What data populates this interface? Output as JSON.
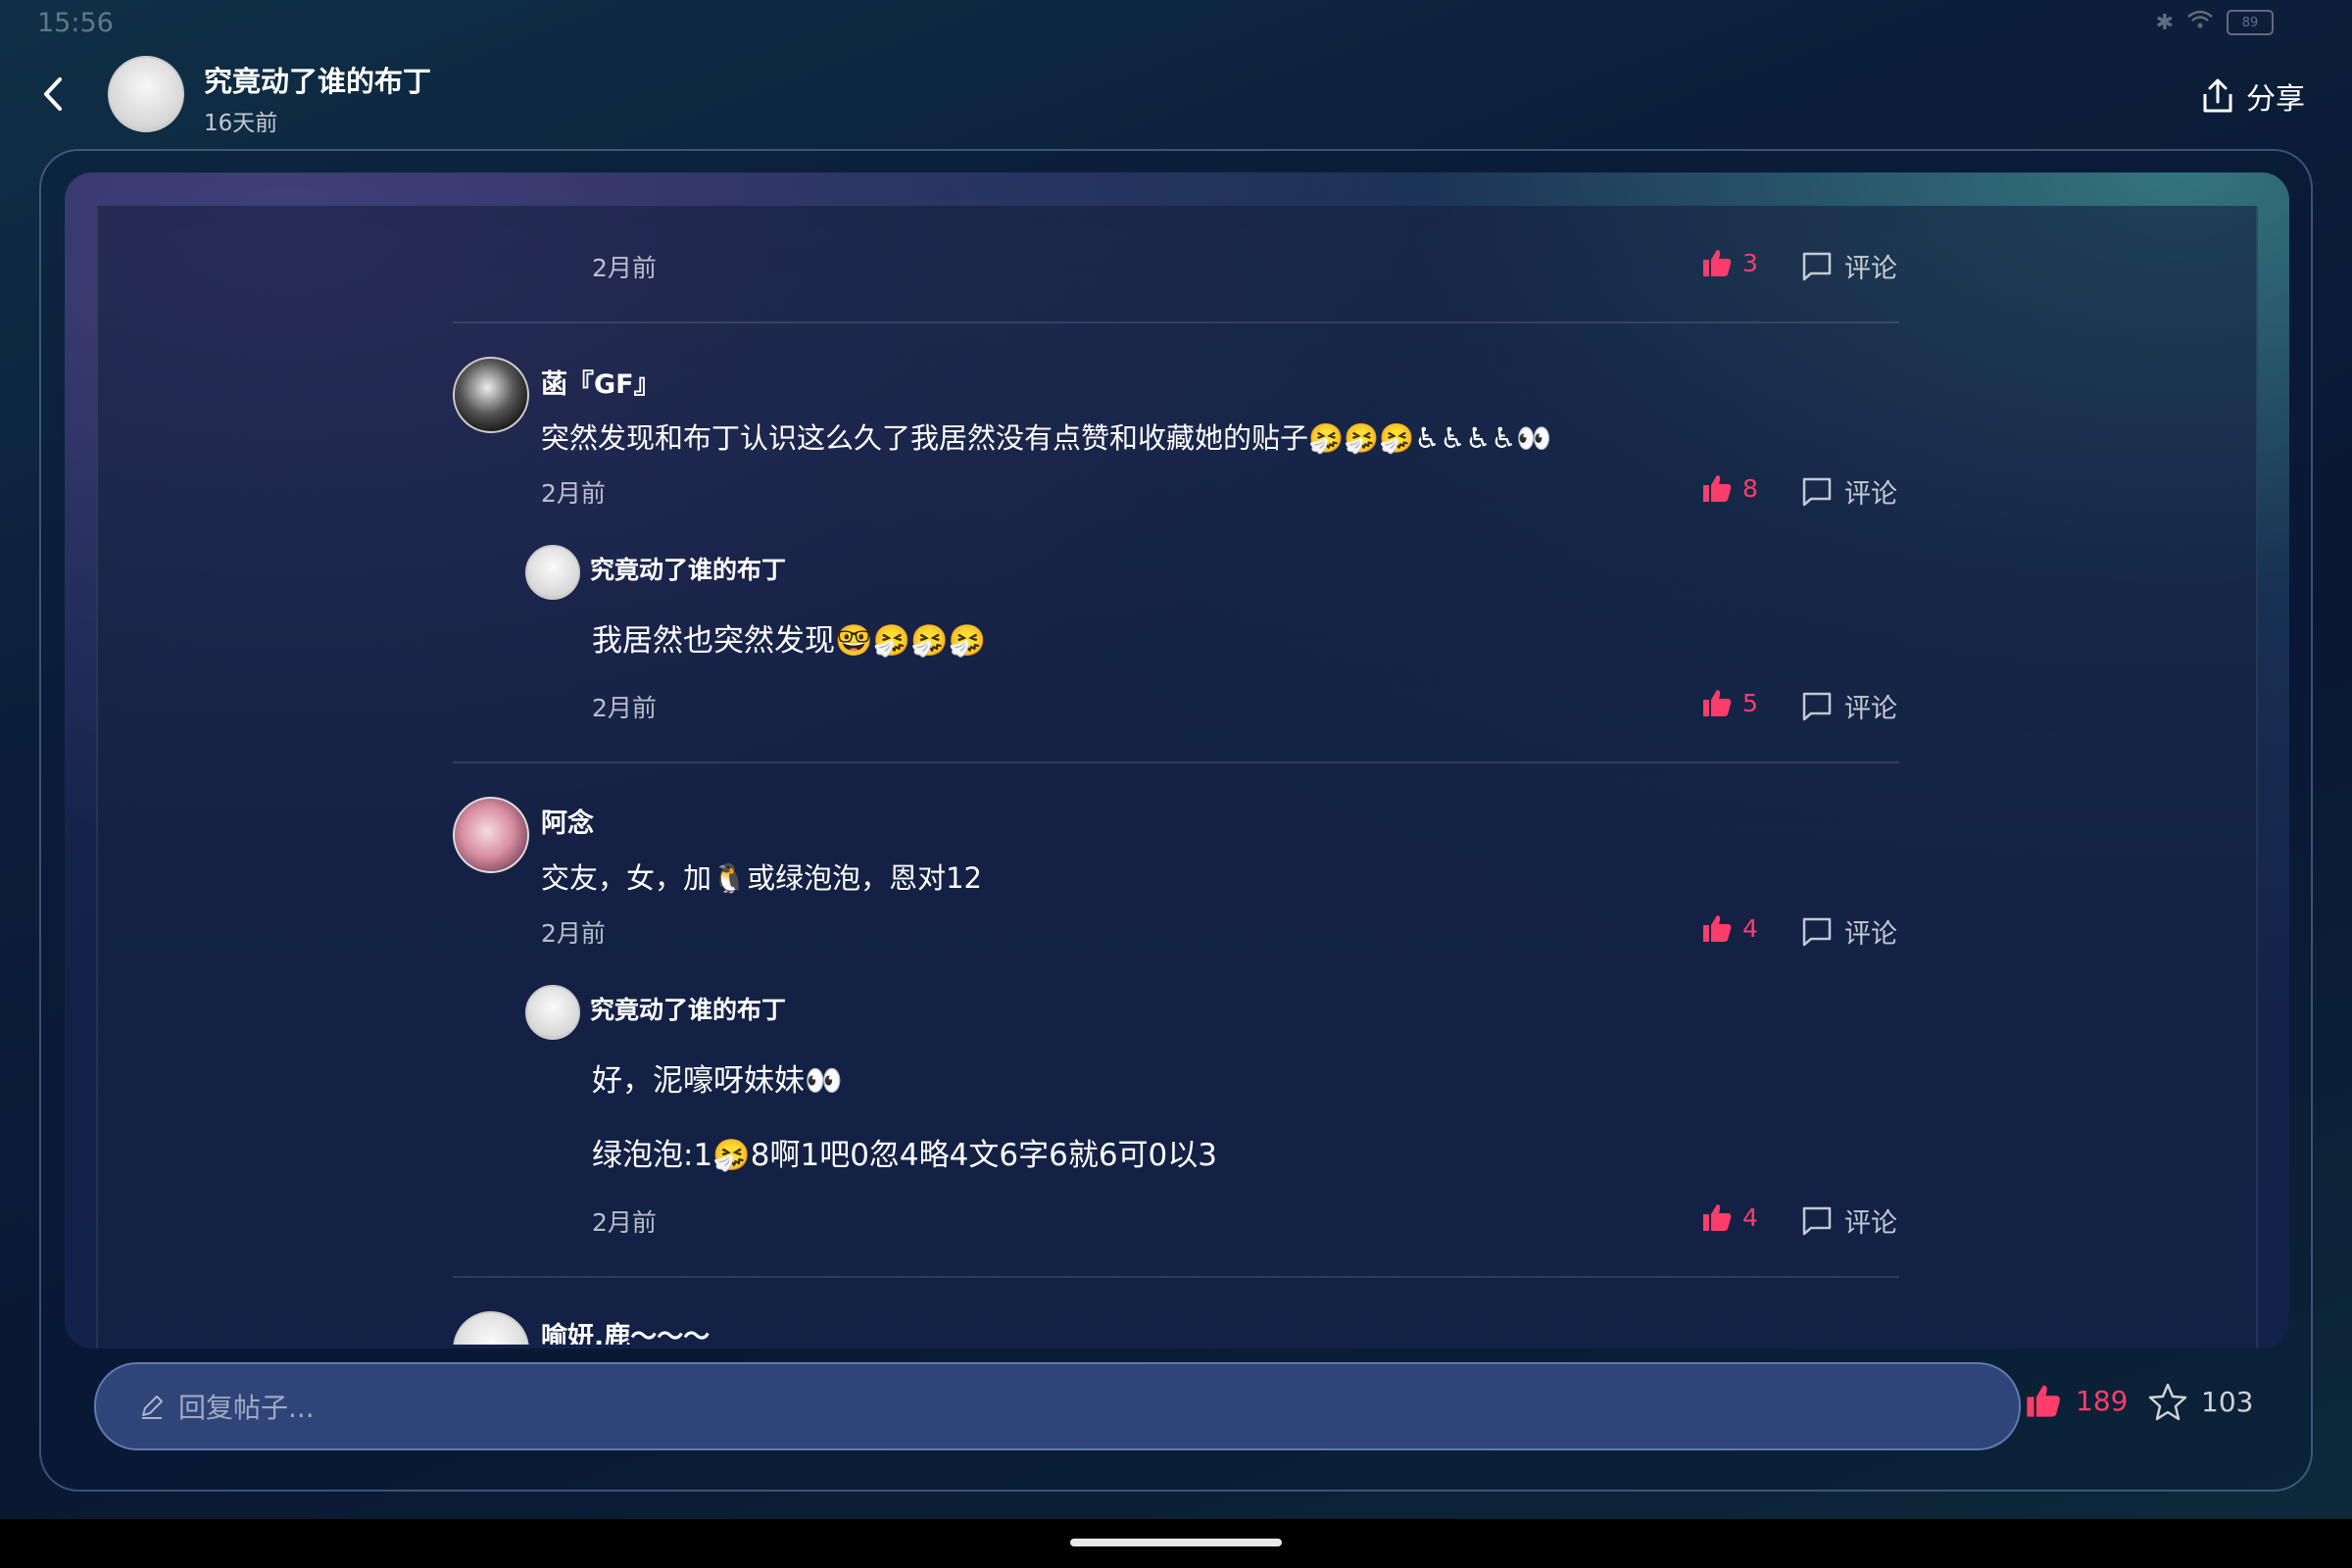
{
  "status_bar": {
    "time": "15:56",
    "battery": "89"
  },
  "header": {
    "author": "究竟动了谁的布丁",
    "time": "16天前",
    "share_label": "分享"
  },
  "comments": [
    {
      "time": "2月前",
      "likes": "3",
      "comment_label": "评论"
    },
    {
      "author": "菡『GF』",
      "text": "突然发现和布丁认识这么久了我居然没有点赞和收藏她的贴子🤧🤧🤧♿♿♿♿👀",
      "time": "2月前",
      "likes": "8",
      "comment_label": "评论",
      "reply": {
        "author": "究竟动了谁的布丁",
        "text": "我居然也突然发现🤓🤧🤧🤧",
        "time": "2月前",
        "likes": "5",
        "comment_label": "评论"
      }
    },
    {
      "author": "阿念",
      "text": "交友，女，加🐧或绿泡泡，恩对12",
      "time": "2月前",
      "likes": "4",
      "comment_label": "评论",
      "reply": {
        "author": "究竟动了谁的布丁",
        "text_line1": "好，泥嚎呀妹妹👀",
        "text_line2": "绿泡泡:1🤧8啊1吧0忽4略4文6字6就6可0以3",
        "time": "2月前",
        "likes": "4",
        "comment_label": "评论"
      }
    },
    {
      "author": "喻妍.鹿〜〜〜"
    }
  ],
  "bottom_bar": {
    "placeholder": "回复帖子...",
    "likes": "189",
    "favorites": "103"
  },
  "colors": {
    "like": "#ff3d6a",
    "input_bg": "#2f4478"
  }
}
